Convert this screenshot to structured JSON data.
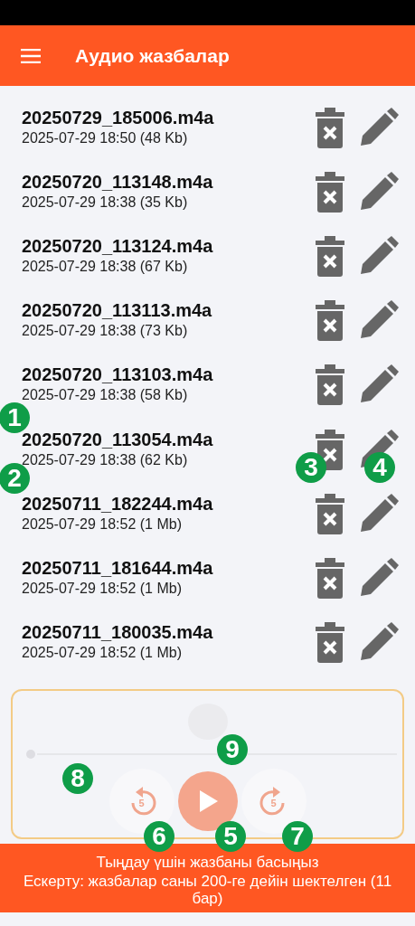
{
  "app_bar": {
    "title": "Аудио жазбалар"
  },
  "recordings": [
    {
      "name": "20250729_185006.m4a",
      "info": "2025-07-29 18:50 (48 Kb)"
    },
    {
      "name": "20250720_113148.m4a",
      "info": "2025-07-29 18:38 (35 Kb)"
    },
    {
      "name": "20250720_113124.m4a",
      "info": "2025-07-29 18:38 (67 Kb)"
    },
    {
      "name": "20250720_113113.m4a",
      "info": "2025-07-29 18:38 (73 Kb)"
    },
    {
      "name": "20250720_113103.m4a",
      "info": "2025-07-29 18:38 (58 Kb)"
    },
    {
      "name": "20250720_113054.m4a",
      "info": "2025-07-29 18:38 (62 Kb)"
    },
    {
      "name": "20250711_182244.m4a",
      "info": "2025-07-29 18:52 (1 Mb)"
    },
    {
      "name": "20250711_181644.m4a",
      "info": "2025-07-29 18:52 (1 Mb)"
    },
    {
      "name": "20250711_180035.m4a",
      "info": "2025-07-29 18:52 (1 Mb)"
    }
  ],
  "player": {
    "level": 0,
    "rewind_label": "5",
    "forward_label": "5"
  },
  "footer": {
    "hint": "Тыңдау үшін жазбаны басыңыз",
    "warning": "Ескерту: жазбалар саны 200-ге дейін шектелген (11 бар)"
  },
  "markers": [
    {
      "label": "1"
    },
    {
      "label": "2"
    },
    {
      "label": "3"
    },
    {
      "label": "4"
    },
    {
      "label": "9"
    },
    {
      "label": "8"
    },
    {
      "label": "6"
    },
    {
      "label": "5"
    },
    {
      "label": "7"
    }
  ]
}
